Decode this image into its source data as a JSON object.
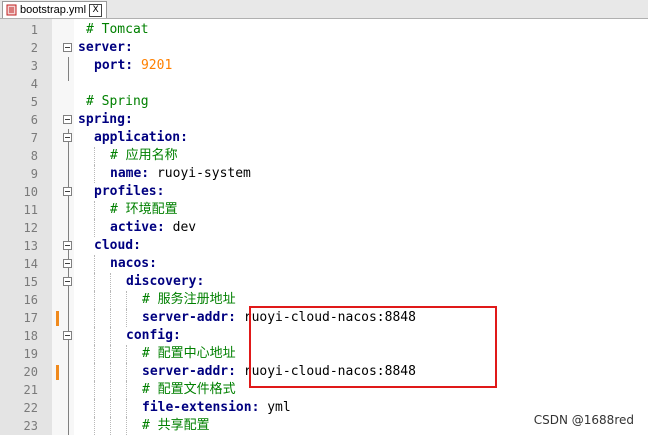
{
  "tab": {
    "filename": "bootstrap.yml",
    "close": "X"
  },
  "lines": [
    {
      "num": "1",
      "seg": [
        [
          "c",
          "# Tomcat"
        ]
      ],
      "indent": 1
    },
    {
      "num": "2",
      "seg": [
        [
          "k",
          "server:"
        ]
      ],
      "indent": 0,
      "fold": true
    },
    {
      "num": "3",
      "seg": [
        [
          "k",
          "port:"
        ],
        [
          "t",
          " "
        ],
        [
          "n",
          "9201"
        ]
      ],
      "indent": 2
    },
    {
      "num": "4",
      "seg": [],
      "indent": 0
    },
    {
      "num": "5",
      "seg": [
        [
          "c",
          "# Spring"
        ]
      ],
      "indent": 1
    },
    {
      "num": "6",
      "seg": [
        [
          "k",
          "spring:"
        ]
      ],
      "indent": 0,
      "fold": true
    },
    {
      "num": "7",
      "seg": [
        [
          "k",
          "application:"
        ]
      ],
      "indent": 2,
      "fold": true
    },
    {
      "num": "8",
      "seg": [
        [
          "c",
          "# 应用名称"
        ]
      ],
      "indent": 4
    },
    {
      "num": "9",
      "seg": [
        [
          "k",
          "name:"
        ],
        [
          "t",
          " ruoyi-system"
        ]
      ],
      "indent": 4
    },
    {
      "num": "10",
      "seg": [
        [
          "k",
          "profiles:"
        ]
      ],
      "indent": 2,
      "fold": true
    },
    {
      "num": "11",
      "seg": [
        [
          "c",
          "# 环境配置"
        ]
      ],
      "indent": 4
    },
    {
      "num": "12",
      "seg": [
        [
          "k",
          "active:"
        ],
        [
          "t",
          " dev"
        ]
      ],
      "indent": 4
    },
    {
      "num": "13",
      "seg": [
        [
          "k",
          "cloud:"
        ]
      ],
      "indent": 2,
      "fold": true
    },
    {
      "num": "14",
      "seg": [
        [
          "k",
          "nacos:"
        ]
      ],
      "indent": 4,
      "fold": true
    },
    {
      "num": "15",
      "seg": [
        [
          "k",
          "discovery:"
        ]
      ],
      "indent": 6,
      "fold": true
    },
    {
      "num": "16",
      "seg": [
        [
          "c",
          "# 服务注册地址"
        ]
      ],
      "indent": 8
    },
    {
      "num": "17",
      "seg": [
        [
          "k",
          "server-addr:"
        ],
        [
          "t",
          " ruoyi-cloud-nacos:8848"
        ]
      ],
      "indent": 8,
      "changed": true
    },
    {
      "num": "18",
      "seg": [
        [
          "k",
          "config:"
        ]
      ],
      "indent": 6,
      "fold": true
    },
    {
      "num": "19",
      "seg": [
        [
          "c",
          "# 配置中心地址"
        ]
      ],
      "indent": 8
    },
    {
      "num": "20",
      "seg": [
        [
          "k",
          "server-addr:"
        ],
        [
          "t",
          " ruoyi-cloud-nacos:8848"
        ]
      ],
      "indent": 8,
      "changed": true
    },
    {
      "num": "21",
      "seg": [
        [
          "c",
          "# 配置文件格式"
        ]
      ],
      "indent": 8
    },
    {
      "num": "22",
      "seg": [
        [
          "k",
          "file-extension:"
        ],
        [
          "t",
          " yml"
        ]
      ],
      "indent": 8
    },
    {
      "num": "23",
      "seg": [
        [
          "c",
          "# 共享配置"
        ]
      ],
      "indent": 8
    }
  ],
  "watermark": "CSDN @1688red"
}
